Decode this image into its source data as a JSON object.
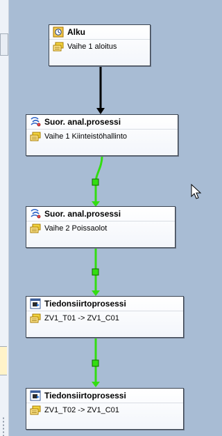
{
  "nodes": [
    {
      "title": "Alku",
      "subtitle": "Vaihe 1 aloitus",
      "title_icon": "clock-icon",
      "sub_icon": "step-icon"
    },
    {
      "title": "Suor. anal.prosessi",
      "subtitle": "Vaihe 1 Kiinteistöhallinto",
      "title_icon": "process-icon",
      "sub_icon": "step-icon"
    },
    {
      "title": "Suor. anal.prosessi",
      "subtitle": "Vaihe 2 Poissaolot",
      "title_icon": "process-icon",
      "sub_icon": "step-icon"
    },
    {
      "title": "Tiedonsiirtoprosessi",
      "subtitle": "ZV1_T01 -> ZV1_C01",
      "title_icon": "transfer-icon",
      "sub_icon": "step-icon"
    },
    {
      "title": "Tiedonsiirtoprosessi",
      "subtitle": "ZV1_T02 -> ZV1_C01",
      "title_icon": "transfer-icon",
      "sub_icon": "step-icon"
    }
  ],
  "colors": {
    "canvas": "#a8bcd4",
    "start_connector": "#000000",
    "success_connector": "#33dd11",
    "node_border": "#3c4552"
  }
}
